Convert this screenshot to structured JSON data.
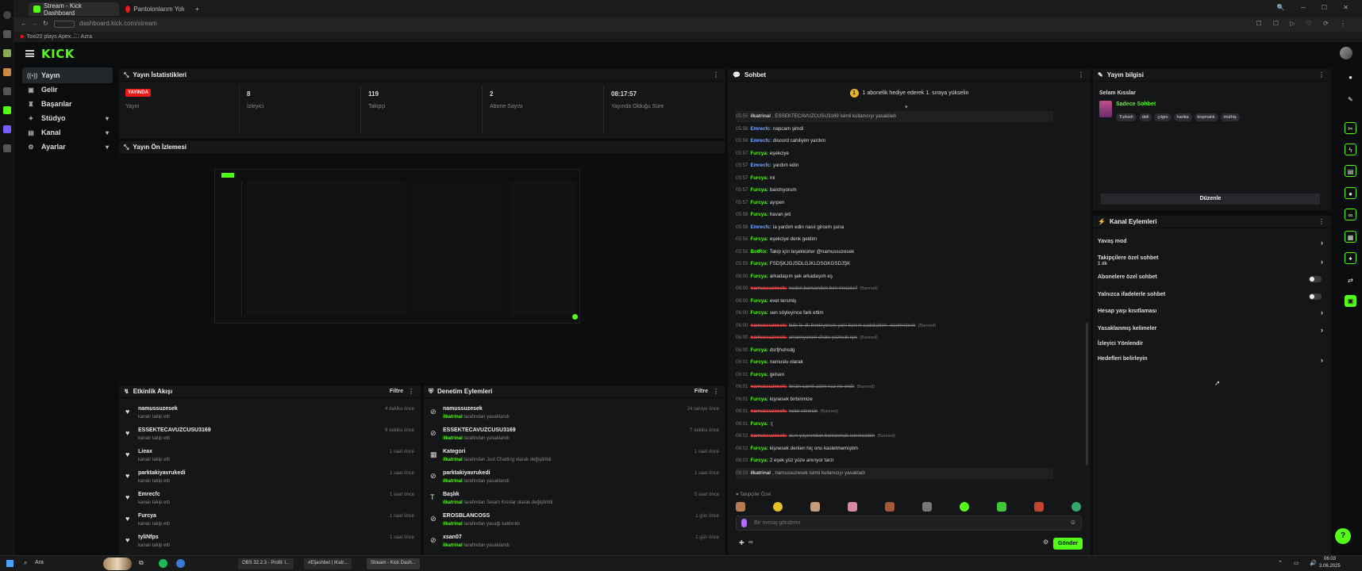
{
  "browser": {
    "tabs": [
      {
        "title": "Stream - Kick Dashboard",
        "active": true
      },
      {
        "title": "Pantolonlarım Yoldu Fakir"
      }
    ],
    "new_tab": "+",
    "url": "dashboard.kick.com/stream",
    "bookmarks": [
      {
        "label": "Toxi20 plays Apex..."
      },
      {
        "label": "Azra"
      }
    ]
  },
  "kick": {
    "logo": "KICK"
  },
  "nav": {
    "items": [
      {
        "label": "Yayın",
        "icon": "broadcast-icon",
        "glyph": "((•))"
      },
      {
        "label": "Gelir",
        "icon": "wallet-icon",
        "glyph": "▣"
      },
      {
        "label": "Başarılar",
        "icon": "trophy-icon",
        "glyph": "♜"
      },
      {
        "label": "Stüdyo",
        "icon": "studio-icon",
        "glyph": "✦",
        "chevron": "▾"
      },
      {
        "label": "Kanal",
        "icon": "channel-icon",
        "glyph": "▤",
        "chevron": "▾"
      },
      {
        "label": "Ayarlar",
        "icon": "settings-icon",
        "glyph": "⚙",
        "chevron": "▾"
      }
    ]
  },
  "stats_panel": {
    "title": "Yayın İstatistikleri",
    "kebab": "⋮",
    "live_badge": "YAYINDA",
    "live_label": "Yayın",
    "stats": [
      {
        "value": "8",
        "label": "İzleyici"
      },
      {
        "value": "119",
        "label": "Takipçi"
      },
      {
        "value": "2",
        "label": "Abone Sayısı"
      },
      {
        "value": "08:17:57",
        "label": "Yayında Olduğu Süre"
      }
    ]
  },
  "preview_panel": {
    "title": "Yayın Ön İzlemesi"
  },
  "activity_feed": {
    "title": "Etkinlik Akışı",
    "filter_label": "Filtre",
    "kebab": "⋮",
    "items": [
      {
        "name": "namussuzesek",
        "desc": "kanalı takip etti",
        "time": "4 dakika önce"
      },
      {
        "name": "ESSEKTECAVUZCUSU3169",
        "desc": "kanalı takip etti",
        "time": "9 dakika önce"
      },
      {
        "name": "Lieax",
        "desc": "kanalı takip etti",
        "time": "1 saat önce"
      },
      {
        "name": "parktakiyavrukedi",
        "desc": "kanalı takip etti",
        "time": "1 saat önce"
      },
      {
        "name": "Emrecfc",
        "desc": "kanalı takip etti",
        "time": "1 saat önce"
      },
      {
        "name": "Furcya",
        "desc": "kanalı takip etti",
        "time": "1 saat önce"
      },
      {
        "name": "tyliNfps",
        "desc": "kanalı takip etti",
        "time": "1 saat önce"
      }
    ]
  },
  "moderation": {
    "title": "Denetim Eylemleri",
    "filter_label": "Filtre",
    "kebab": "⋮",
    "items": [
      {
        "icon": "ban-icon",
        "glyph": "⊘",
        "name": "namussuzesek",
        "actor": "ilkatrinal",
        "tail": "tarafından yasaklandı",
        "time": "24 saniye önce"
      },
      {
        "icon": "ban-icon",
        "glyph": "⊘",
        "name": "ESSEKTECAVUZCUSU3169",
        "actor": "ilkatrinal",
        "tail": "tarafından yasaklandı",
        "time": "7 dakika önce"
      },
      {
        "icon": "category-icon",
        "glyph": "▦",
        "name": "Kategori",
        "actor": "ilkatrinal",
        "tail": "tarafından Just Chatting olarak değiştirildi",
        "time": "1 saat önce"
      },
      {
        "icon": "ban-icon",
        "glyph": "⊘",
        "name": "parktakiyavrukedi",
        "actor": "ilkatrinal",
        "tail": "tarafından yasaklandı",
        "time": "1 saat önce"
      },
      {
        "icon": "title-icon",
        "glyph": "T",
        "name": "Başlık",
        "actor": "ilkatrinal",
        "tail": "tarafından Selam Kısslar olarak değiştirildi",
        "time": "5 saat önce"
      },
      {
        "icon": "unban-icon",
        "glyph": "⊘",
        "name": "EROSBLANCOSS",
        "actor": "ilkatrinal",
        "tail": "tarafından yasağı kaldırıldı",
        "time": "1 gün önce"
      },
      {
        "icon": "ban-icon",
        "glyph": "⊘",
        "name": "xsan07",
        "actor": "ilkatrinal",
        "tail": "tarafından yasaklandı",
        "time": "1 gün önce"
      }
    ]
  },
  "chat": {
    "title": "Sohbet",
    "kebab": "⋮",
    "pinned": "1 abonelik hediye ederek 1. sıraya yükselin",
    "pinned_rank": "1",
    "lines": [
      {
        "ts": "05:55",
        "user": "ilkatrinal",
        "msg": ", ESSEKTECAVUZCUSU3169 isimli kullanıcıyı yasakladı",
        "color": "#cfcfcf",
        "kind": "sys"
      },
      {
        "ts": "05:56",
        "user": "Emrecfc:",
        "msg": "napcam şimdi",
        "color": "#7aa7ff"
      },
      {
        "ts": "05:56",
        "user": "Emrecfc:",
        "msg": "discord cahiliyim yardım",
        "color": "#7aa7ff"
      },
      {
        "ts": "05:57",
        "user": "Furcya:",
        "msg": "eşekciye",
        "color": "#53fc18"
      },
      {
        "ts": "05:57",
        "user": "Emrecfc:",
        "msg": "yardım edin",
        "color": "#7aa7ff"
      },
      {
        "ts": "05:57",
        "user": "Furcya:",
        "msg": "mi",
        "color": "#53fc18"
      },
      {
        "ts": "05:57",
        "user": "Furcya:",
        "msg": "banzlıyorum",
        "color": "#53fc18"
      },
      {
        "ts": "05:57",
        "user": "Furcya:",
        "msg": "ayıpen",
        "color": "#53fc18"
      },
      {
        "ts": "05:58",
        "user": "Furcya:",
        "msg": "havan jeti",
        "color": "#53fc18"
      },
      {
        "ts": "05:58",
        "user": "Emrecfc:",
        "msg": "la yardım edin nasıl gircem şuna",
        "color": "#7aa7ff"
      },
      {
        "ts": "05:59",
        "user": "Furcya:",
        "msg": "eşekciye denk geldim",
        "color": "#53fc18"
      },
      {
        "ts": "05:59",
        "user": "BotRix:",
        "msg": "Takip için teşekkürler @namussuzesek",
        "color": "#53fc18"
      },
      {
        "ts": "05:59",
        "user": "Furcya:",
        "msg": "FSDŞKJGJSDLGJKLDSGKGSDJŞK",
        "color": "#53fc18"
      },
      {
        "ts": "06:00",
        "user": "Furcya:",
        "msg": "arkadaşım şek arkadaşım eş",
        "color": "#53fc18"
      },
      {
        "ts": "06:00",
        "user": "namussuzesek:",
        "msg": "neden banvandım ben meselа?",
        "color": "#ff4d4d",
        "kind": "banned",
        "tag": "(Banned)"
      },
      {
        "ts": "06:00",
        "user": "Furcya:",
        "msg": "evet tersmiş",
        "color": "#53fc18"
      },
      {
        "ts": "06:00",
        "user": "Furcya:",
        "msg": "sen söyleyince fark ettim",
        "color": "#53fc18"
      },
      {
        "ts": "06:00",
        "user": "namussuzesek:",
        "msg": "bide bi dk bekleyorum yani banım sadakatlım. olcemezsek",
        "color": "#ff4d4d",
        "kind": "banned",
        "tag": "(Banned)"
      },
      {
        "ts": "06:00",
        "user": "namussuzesek:",
        "msg": "anlamıyorum chate yazmak için",
        "color": "#ff4d4d",
        "kind": "banned",
        "tag": "(Banned)"
      },
      {
        "ts": "06:00",
        "user": "Furcya:",
        "msg": "dsrfjhshsdg",
        "color": "#53fc18"
      },
      {
        "ts": "06:01",
        "user": "Furcya:",
        "msg": "namuslu olarak",
        "color": "#53fc18"
      },
      {
        "ts": "06:01",
        "user": "Furcya:",
        "msg": "gelsen",
        "color": "#53fc18"
      },
      {
        "ts": "06:01",
        "user": "namussuzesek:",
        "msg": "önüm sanrit adım naz mı emik",
        "color": "#ff4d4d",
        "kind": "banned",
        "tag": "(Banned)"
      },
      {
        "ts": "06:01",
        "user": "Furcya:",
        "msg": "kişnesek birbirimize",
        "color": "#53fc18"
      },
      {
        "ts": "06:01",
        "user": "namussuzesek:",
        "msg": "nolur elmesin",
        "color": "#ff4d4d",
        "kind": "banned",
        "tag": "(Banned)"
      },
      {
        "ts": "06:01",
        "user": "Furcya:",
        "msg": ":(",
        "color": "#53fc18"
      },
      {
        "ts": "06:02",
        "user": "namussuzesek:",
        "msg": "asın yayınından banlanmak istemezdim",
        "color": "#ff4d4d",
        "kind": "banned",
        "tag": "(Banned)"
      },
      {
        "ts": "06:02",
        "user": "Furcya:",
        "msg": "kişnesek derken hiç onu kastetmemiştim",
        "color": "#53fc18"
      },
      {
        "ts": "06:02",
        "user": "Furcya:",
        "msg": "2 eşek yüz yüze anırıyor tarzı",
        "color": "#53fc18"
      },
      {
        "ts": "06:03",
        "user": "ilkatrinal",
        "msg": ", namussuzesek isimli kullanıcıyı yasakladı",
        "color": "#cfcfcf",
        "kind": "sys"
      }
    ],
    "followers_only": "♥ Takipçiler Özel",
    "input_placeholder": "Bir mesaj gönderin",
    "send_label": "Gönder",
    "points_label": "∞"
  },
  "stream_info": {
    "title_header": "Yayın bilgisi",
    "kebab": "⋮",
    "stream_title": "Selam Kısslar",
    "category": "Sadece Sohbet",
    "tags": [
      "Turkish",
      "deli",
      "çılgın",
      "harika",
      "kopmalık",
      "müthiş"
    ],
    "edit_label": "Düzenle"
  },
  "channel_actions": {
    "title": "Kanal Eylemleri",
    "kebab": "⋮",
    "items": [
      {
        "label": "Yavaş mod",
        "type": "arrow"
      },
      {
        "label": "Takipçilere özel sohbet",
        "sub": "1 dk",
        "type": "arrow"
      },
      {
        "label": "Abonelere özel sohbet",
        "type": "toggle"
      },
      {
        "label": "Yalnızca ifadelerle sohbet",
        "type": "toggle"
      },
      {
        "label": "Hesap yaşı kısıtlaması",
        "type": "arrow"
      },
      {
        "label": "Yasaklanmış kelimeler",
        "type": "arrow"
      },
      {
        "label": "İzleyici Yönlendir",
        "type": "none"
      },
      {
        "label": "Hedefleri belirleyin",
        "type": "arrow"
      }
    ]
  },
  "taskbar": {
    "search_label": "Ara",
    "apps": [
      "OBS 32.2.3 - Profil: I...",
      "#Eljashbet | iKatr...",
      "Stream - Kick Dash..."
    ],
    "clock_time": "06:03",
    "clock_date": "3.06.2025"
  },
  "colors": {
    "accent": "#53fc18",
    "live": "#e91916",
    "panel": "#151617",
    "background": "#0b0c0d"
  }
}
